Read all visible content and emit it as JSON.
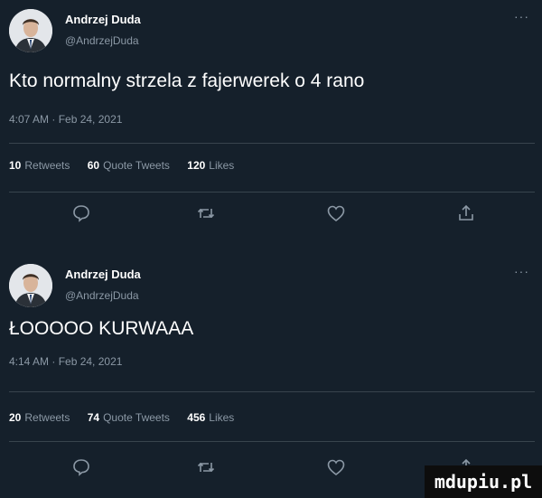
{
  "tweets": [
    {
      "author_name": "Andrzej Duda",
      "author_handle": "@AndrzejDuda",
      "more_icon": "···",
      "text": "Kto normalny strzela z fajerwerek o 4 rano",
      "timestamp": "4:07 AM · Feb 24, 2021",
      "retweets_count": "10",
      "retweets_label": "Retweets",
      "quotes_count": "60",
      "quotes_label": "Quote Tweets",
      "likes_count": "120",
      "likes_label": "Likes",
      "icons": [
        "reply-icon",
        "retweet-icon",
        "like-icon",
        "share-icon"
      ]
    },
    {
      "author_name": "Andrzej Duda",
      "author_handle": "@AndrzejDuda",
      "more_icon": "···",
      "text": "ŁOOOOO KURWAAA",
      "timestamp": "4:14 AM · Feb 24, 2021",
      "retweets_count": "20",
      "retweets_label": "Retweets",
      "quotes_count": "74",
      "quotes_label": "Quote Tweets",
      "likes_count": "456",
      "likes_label": "Likes",
      "icons": [
        "reply-icon",
        "retweet-icon",
        "like-icon",
        "share-icon"
      ]
    }
  ],
  "watermark": "mdupiu.pl",
  "colors": {
    "background": "#15202b",
    "text_primary": "#ffffff",
    "text_secondary": "#8b98a5",
    "divider": "#38444d"
  }
}
